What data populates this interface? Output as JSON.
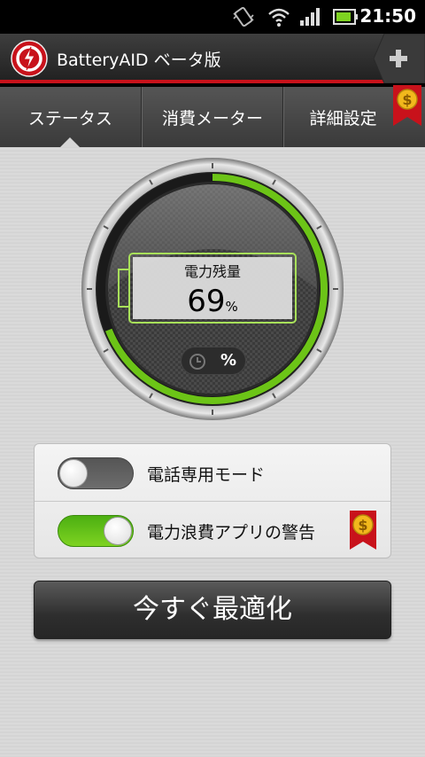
{
  "status_bar": {
    "time": "21:50",
    "icons": [
      "vibrate-icon",
      "wifi-icon",
      "signal-icon",
      "battery-icon"
    ]
  },
  "app": {
    "title": "BatteryAID ベータ版",
    "logo_icon": "batteryaid-logo-icon",
    "add_icon": "plus-icon"
  },
  "tabs": [
    {
      "label": "ステータス",
      "active": true
    },
    {
      "label": "消費メーター",
      "active": false
    },
    {
      "label": "詳細設定",
      "active": false
    }
  ],
  "premium_icon": "dollar-ribbon-icon",
  "gauge": {
    "label": "電力残量",
    "value": "69",
    "unit": "%",
    "level_percent": 69,
    "toggle_unit": "%",
    "accent_color": "#7ed321"
  },
  "settings": {
    "items": [
      {
        "label": "電話専用モード",
        "enabled": false,
        "premium": false
      },
      {
        "label": "電力浪費アプリの警告",
        "enabled": true,
        "premium": true
      }
    ]
  },
  "optimize_button": {
    "label": "今すぐ最適化"
  },
  "colors": {
    "brand_red": "#c8121b",
    "switch_on": "#6cc417",
    "gold": "#f2b81c"
  }
}
